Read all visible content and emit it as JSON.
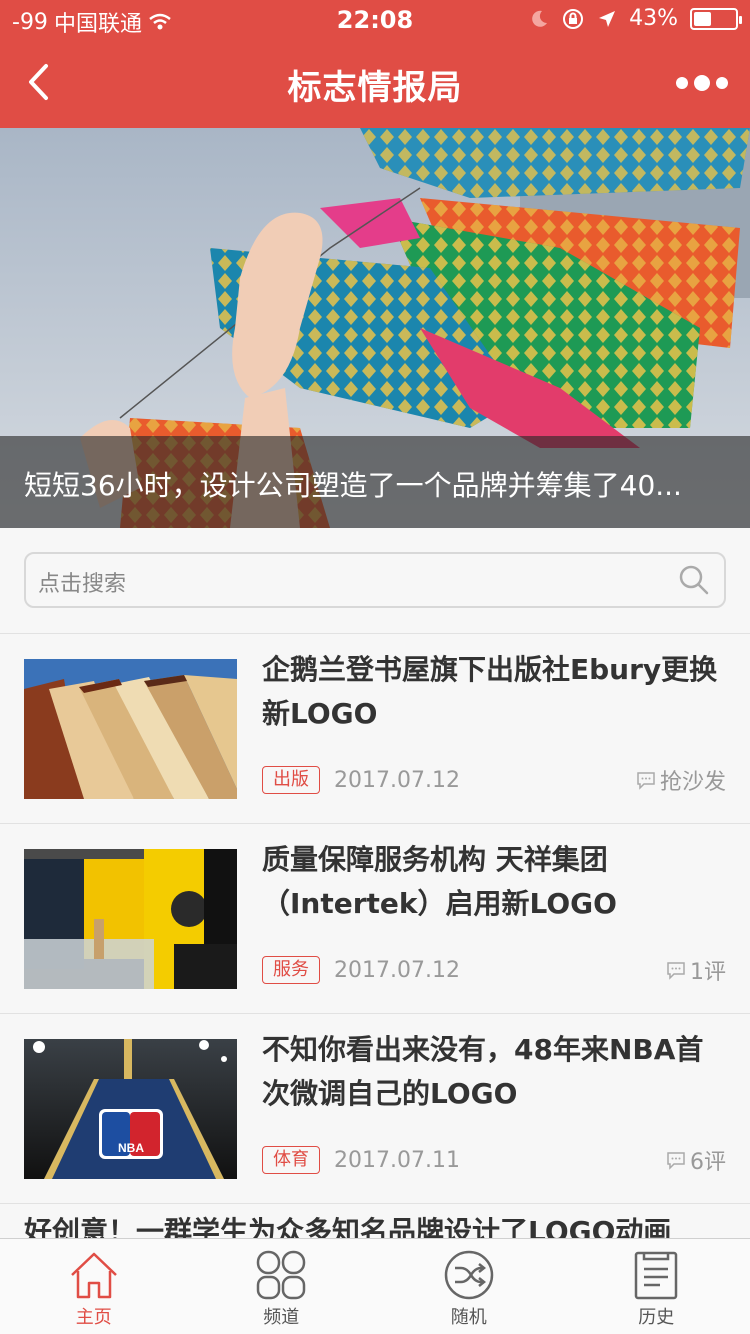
{
  "status_bar": {
    "signal": "-99",
    "carrier": "中国联通",
    "time": "22:08",
    "battery": "43%",
    "battery_level": 0.43
  },
  "navbar": {
    "title": "标志情报局"
  },
  "hero": {
    "caption": "短短36小时，设计公司塑造了一个品牌并筹集了40..."
  },
  "search": {
    "placeholder": "点击搜索"
  },
  "articles": [
    {
      "title": "企鹅兰登书屋旗下出版社Ebury更换新LOGO",
      "tag": "出版",
      "date": "2017.07.12",
      "comments": "抢沙发"
    },
    {
      "title": "质量保障服务机构 天祥集团（Intertek）启用新LOGO",
      "tag": "服务",
      "date": "2017.07.12",
      "comments": "1评"
    },
    {
      "title": "不知你看出来没有，48年来NBA首次微调自己的LOGO",
      "tag": "体育",
      "date": "2017.07.11",
      "comments": "6评"
    }
  ],
  "partial_article": {
    "title": "好创意！一群学生为众多知名品牌设计了LOGO动画"
  },
  "tabbar": [
    {
      "label": "主页",
      "icon": "home-icon",
      "active": true
    },
    {
      "label": "频道",
      "icon": "channels-icon",
      "active": false
    },
    {
      "label": "随机",
      "icon": "shuffle-icon",
      "active": false
    },
    {
      "label": "历史",
      "icon": "history-icon",
      "active": false
    }
  ],
  "colors": {
    "accent": "#e04d45",
    "background": "#f7f7f7"
  }
}
